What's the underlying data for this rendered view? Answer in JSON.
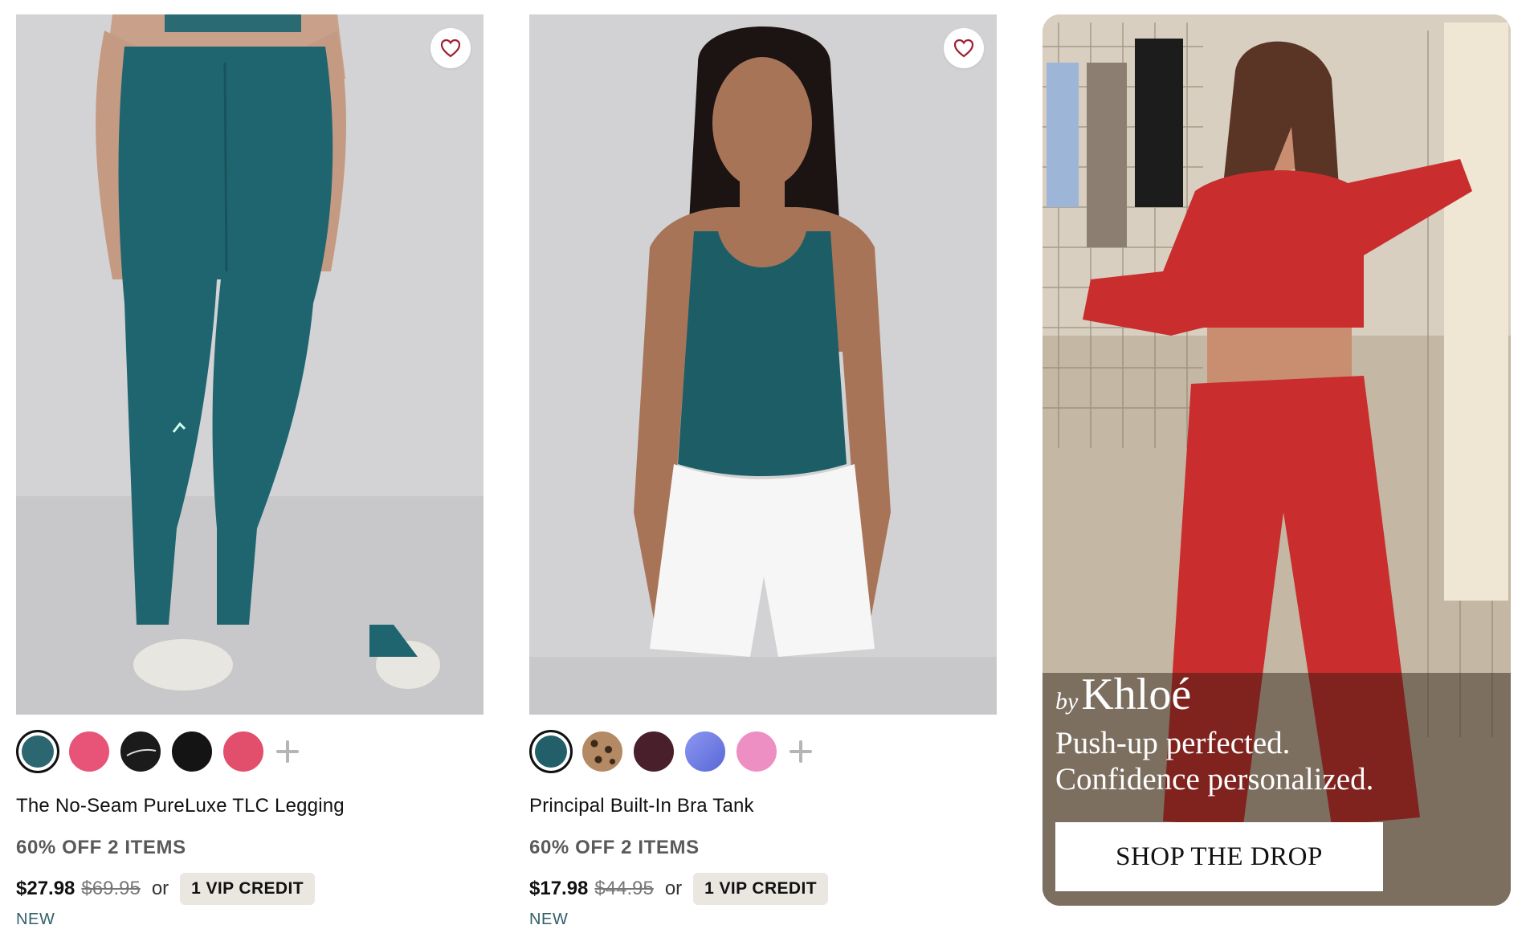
{
  "products": [
    {
      "title": "The No-Seam PureLuxe TLC Legging",
      "promo": "60% OFF 2 ITEMS",
      "price": "$27.98",
      "original_price": "$69.95",
      "or_label": "or",
      "vip_label": "1 VIP CREDIT",
      "badge": "NEW",
      "more_colors_icon": "plus-icon",
      "swatches": [
        {
          "name": "teal",
          "color": "#2c6670",
          "selected": true
        },
        {
          "name": "pink",
          "color": "#e85478"
        },
        {
          "name": "black-with-stripe",
          "color": "#1b1b1b"
        },
        {
          "name": "black",
          "color": "#141414"
        },
        {
          "name": "coral-pink",
          "color": "#e24f6c"
        }
      ]
    },
    {
      "title": "Principal Built-In Bra Tank",
      "promo": "60% OFF 2 ITEMS",
      "price": "$17.98",
      "original_price": "$44.95",
      "or_label": "or",
      "vip_label": "1 VIP CREDIT",
      "badge": "NEW",
      "more_colors_icon": "plus-icon",
      "swatches": [
        {
          "name": "teal",
          "color": "#235f69",
          "selected": true
        },
        {
          "name": "leopard",
          "color": "#b48a64"
        },
        {
          "name": "plum",
          "color": "#4a1f2c"
        },
        {
          "name": "periwinkle-blue",
          "color": "#6d7be0"
        },
        {
          "name": "pink",
          "color": "#ee8fc3"
        }
      ]
    }
  ],
  "promo_banner": {
    "brand_prefix": "by",
    "brand_name": "Khloé",
    "tagline_line1": "Push-up perfected.",
    "tagline_line2": "Confidence personalized.",
    "cta_label": "SHOP THE DROP"
  },
  "colors": {
    "legging": "#1f6570",
    "tank": "#1d5e66",
    "sweatsuit": "#c92d2d",
    "accent_new": "#2f5f68"
  }
}
